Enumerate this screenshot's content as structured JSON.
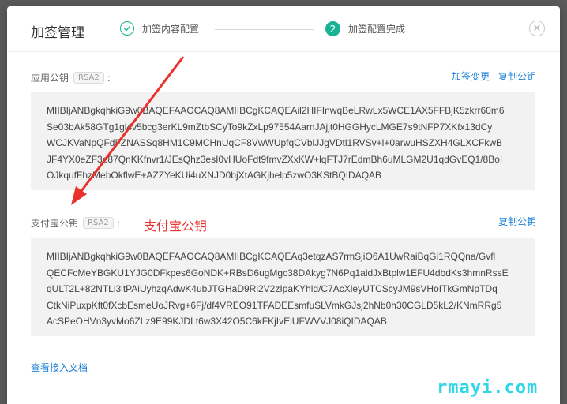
{
  "modal": {
    "title": "加签管理",
    "steps": [
      {
        "label": "加签内容配置",
        "state": "done"
      },
      {
        "label": "加签配置完成",
        "state": "active",
        "number": "2"
      }
    ],
    "close_icon": "close-circle-icon"
  },
  "app_key": {
    "label": "应用公钥",
    "algo": "RSA2",
    "colon": ":",
    "actions": {
      "change": "加签变更",
      "copy": "复制公钥"
    },
    "lines": [
      "MIIBIjANBgkqhkiG9w0BAQEFAAOCAQ8AMIIBCgKCAQEAil2HIFInwqBeLRwLx5WCE1AX5FFBjK5zkrr60m6",
      "Se03bAk58GTg1gl​4v5bcg3erKL9mZtbSCyTo9kZxLp97554AarnJAjjt0HGGHycLMGE7s9tNFP7XKfx13dCy",
      "WCJKVaNpQFdFZNASSq8HM1C9MCHnUqCF8VwWUpfqCVblJJgVDtl1RVSv+l+0arwuHSZXH4GLXCFkwB",
      "JF4YX0eZF3e87QnKKfnvr1/JEsQhz3esI0vHUoFdt9fmvZXxKW+lqFTJ7rEdmBh6uMLGM2U1qdGvEQ1/8BoI",
      "OJkqufFhzMebOkflwE+AZZYeKUi4uXNJD0bjXtAGKjhelp5zwO3KStBQIDAQAB"
    ]
  },
  "alipay_key": {
    "label": "支付宝公钥",
    "algo": "RSA2",
    "colon": ":",
    "actions": {
      "copy": "复制公钥"
    },
    "lines": [
      "MIIBIjANBgkqhkiG9w0BAQEFAAOCAQ8AMIIBCgKCAQEAq3etqzAS7rmSjiO6A1UwRaiBqGi1RQQna/Gvfl",
      "QECFcMeYBGKU1YJG0DFkpes6GoNDK+RBsD6ugMgc38DAkyg7N6Pq1aldJxBtplw1EFU4dbdKs3hmnRssE",
      "qULT2L+82NTLi3ltPAiUyhzqAdwK4ubJTGHaD9Ri2V2zIpaKYhld/C7AcXleyUTCScyJM9sVHoITkGmNpTDq",
      "CtkNiPuxpKft0fXcbEsmeUoJRvg+6Fj/df4VREO91TFADEEsmfuSLVmkGJsj2hNb0h30CGLD5kL2/KNmRRg5",
      "AcSPeOHVn3yvMo6ZLz9E99KJDLt6w3X42O5C6kFKjIvElUFWVVJ08iQIDAQAB"
    ]
  },
  "annotation": "支付宝公钥",
  "doc_link": "查看接入文档",
  "watermark": "rmayi.com",
  "colors": {
    "accent": "#19b394",
    "link": "#1a7fd6",
    "annotation": "#e8322b",
    "watermark": "#2fd6e6"
  }
}
